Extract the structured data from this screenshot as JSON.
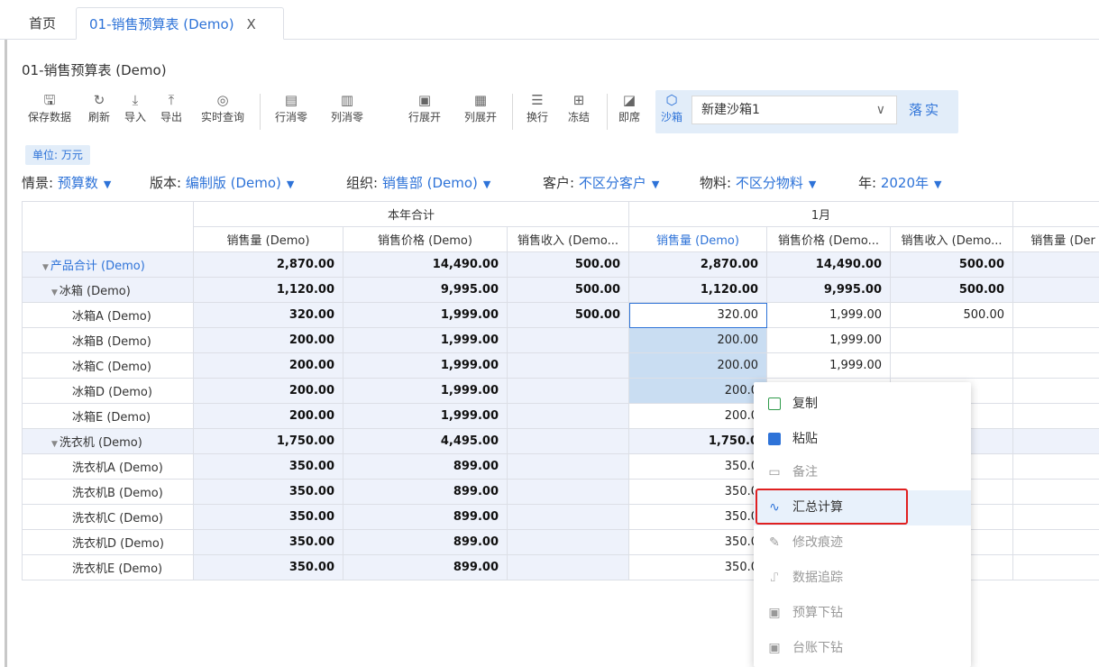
{
  "tabs": {
    "home": "首页",
    "active": "01-销售预算表 (Demo)",
    "close": "X"
  },
  "page_title": "01-销售预算表 (Demo)",
  "toolbar": {
    "save": "保存数据",
    "refresh": "刷新",
    "import": "导入",
    "export": "导出",
    "realtime_query": "实时查询",
    "row_zero": "行消零",
    "col_zero": "列消零",
    "row_expand": "行展开",
    "col_expand": "列展开",
    "wrap": "换行",
    "freeze": "冻结",
    "instant": "即席",
    "sandbox": "沙箱",
    "sandbox_value": "新建沙箱1",
    "commit": "落实"
  },
  "unit_label": "单位: 万元",
  "filters": {
    "scenario_label": "情景:",
    "scenario_value": "预算数",
    "version_label": "版本:",
    "version_value": "编制版 (Demo)",
    "org_label": "组织:",
    "org_value": "销售部 (Demo)",
    "customer_label": "客户:",
    "customer_value": "不区分客户",
    "material_label": "物料:",
    "material_value": "不区分物料",
    "year_label": "年:",
    "year_value": "2020年"
  },
  "grid": {
    "groups": [
      "本年合计",
      "1月"
    ],
    "columns": [
      "销售量 (Demo)",
      "销售价格 (Demo)",
      "销售收入 (Demo...",
      "销售量 (Demo)",
      "销售价格 (Demo...",
      "销售收入 (Demo...",
      "销售量 (Der"
    ],
    "rows": [
      {
        "label": "产品合计 (Demo)",
        "v": [
          "2,870.00",
          "14,490.00",
          "500.00",
          "2,870.00",
          "14,490.00",
          "500.00",
          ""
        ]
      },
      {
        "label": "冰箱 (Demo)",
        "v": [
          "1,120.00",
          "9,995.00",
          "500.00",
          "1,120.00",
          "9,995.00",
          "500.00",
          ""
        ]
      },
      {
        "label": "冰箱A (Demo)",
        "v": [
          "320.00",
          "1,999.00",
          "500.00",
          "320.00",
          "1,999.00",
          "500.00",
          ""
        ]
      },
      {
        "label": "冰箱B (Demo)",
        "v": [
          "200.00",
          "1,999.00",
          "",
          "200.00",
          "1,999.00",
          "",
          ""
        ]
      },
      {
        "label": "冰箱C (Demo)",
        "v": [
          "200.00",
          "1,999.00",
          "",
          "200.00",
          "1,999.00",
          "",
          ""
        ]
      },
      {
        "label": "冰箱D (Demo)",
        "v": [
          "200.00",
          "1,999.00",
          "",
          "200.0",
          "",
          "",
          ""
        ]
      },
      {
        "label": "冰箱E (Demo)",
        "v": [
          "200.00",
          "1,999.00",
          "",
          "200.0",
          "",
          "",
          ""
        ]
      },
      {
        "label": "洗衣机 (Demo)",
        "v": [
          "1,750.00",
          "4,495.00",
          "",
          "1,750.0",
          "",
          "",
          ""
        ]
      },
      {
        "label": "洗衣机A (Demo)",
        "v": [
          "350.00",
          "899.00",
          "",
          "350.0",
          "",
          "",
          ""
        ]
      },
      {
        "label": "洗衣机B (Demo)",
        "v": [
          "350.00",
          "899.00",
          "",
          "350.0",
          "",
          "",
          ""
        ]
      },
      {
        "label": "洗衣机C (Demo)",
        "v": [
          "350.00",
          "899.00",
          "",
          "350.0",
          "",
          "",
          ""
        ]
      },
      {
        "label": "洗衣机D (Demo)",
        "v": [
          "350.00",
          "899.00",
          "",
          "350.0",
          "",
          "",
          ""
        ]
      },
      {
        "label": "洗衣机E (Demo)",
        "v": [
          "350.00",
          "899.00",
          "",
          "350.0",
          "",
          "",
          ""
        ]
      }
    ]
  },
  "context_menu": {
    "copy": "复制",
    "paste": "粘贴",
    "note": "备注",
    "summary_calc": "汇总计算",
    "edit_trace": "修改痕迹",
    "data_trace": "数据追踪",
    "budget_drill": "预算下钻",
    "ledger_drill": "台账下钻"
  },
  "colors": {
    "accent": "#2e73d8",
    "sum_bg": "#eef2fb",
    "selection_bg": "#c9ddf2",
    "highlight_box": "#e02020"
  }
}
